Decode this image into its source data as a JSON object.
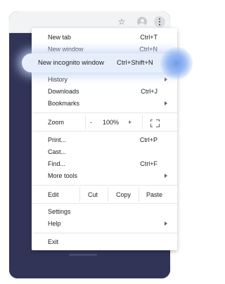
{
  "toolbar": {
    "star_icon": "star-icon",
    "profile_icon": "avatar-icon",
    "menu_icon": "kebab-menu-icon"
  },
  "menu": {
    "new_tab": {
      "label": "New tab",
      "shortcut": "Ctrl+T"
    },
    "new_window": {
      "label": "New window",
      "shortcut": "Ctrl+N"
    },
    "new_incognito": {
      "label": "New incognito window",
      "shortcut": "Ctrl+Shift+N"
    },
    "history": {
      "label": "History"
    },
    "downloads": {
      "label": "Downloads",
      "shortcut": "Ctrl+J"
    },
    "bookmarks": {
      "label": "Bookmarks"
    },
    "zoom": {
      "label": "Zoom",
      "minus": "-",
      "value": "100%",
      "plus": "+"
    },
    "print": {
      "label": "Print...",
      "shortcut": "Ctrl+P"
    },
    "cast": {
      "label": "Cast..."
    },
    "find": {
      "label": "Find...",
      "shortcut": "Ctrl+F"
    },
    "more_tools": {
      "label": "More tools"
    },
    "edit": {
      "label": "Edit",
      "cut": "Cut",
      "copy": "Copy",
      "paste": "Paste"
    },
    "settings": {
      "label": "Settings"
    },
    "help": {
      "label": "Help"
    },
    "exit": {
      "label": "Exit"
    }
  },
  "colors": {
    "page_bg": "#33365a",
    "highlight": "#e6eefc",
    "glow": "#6897ec"
  }
}
